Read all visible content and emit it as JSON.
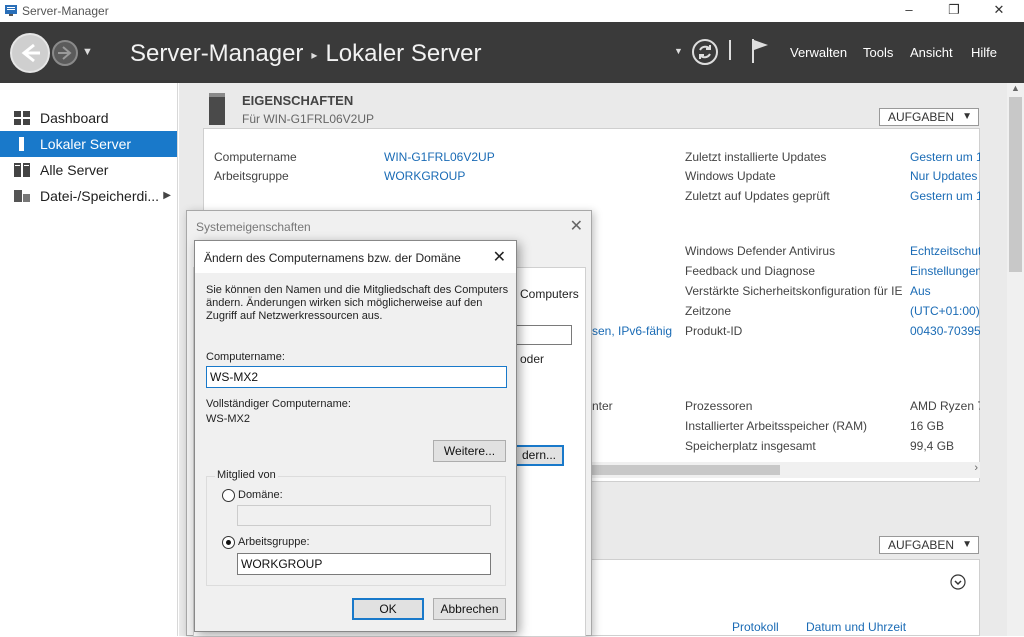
{
  "window": {
    "title": "Server-Manager",
    "controls": {
      "minimize": "–",
      "maximize": "❐",
      "close": "✕"
    }
  },
  "topbar": {
    "breadcrumb": [
      "Server-Manager",
      "Lokaler Server"
    ],
    "breadcrumb_sep": "▸",
    "menu": [
      "Verwalten",
      "Tools",
      "Ansicht",
      "Hilfe"
    ],
    "icons": [
      "back-arrow",
      "forward-arrow",
      "refresh-icon",
      "flag-icon"
    ]
  },
  "sidebar": {
    "items": [
      {
        "label": "Dashboard",
        "icon": "dashboard-icon"
      },
      {
        "label": "Lokaler Server",
        "icon": "server-icon",
        "active": true
      },
      {
        "label": "Alle Server",
        "icon": "servers-icon"
      },
      {
        "label": "Datei-/Speicherdi...",
        "icon": "storage-icon"
      }
    ]
  },
  "properties": {
    "title": "EIGENSCHAFTEN",
    "subtitle": "Für WIN-G1FRL06V2UP",
    "tasks_label": "AUFGABEN",
    "left": [
      {
        "label": "Computername",
        "value": "WIN-G1FRL06V2UP"
      },
      {
        "label": "Arbeitsgruppe",
        "value": "WORKGROUP"
      }
    ],
    "left_partial": {
      "ipv6": "sen, IPv6-fähig",
      "center": "nter"
    },
    "right_top": [
      {
        "label": "Zuletzt installierte Updates",
        "value": "Gestern um 1"
      },
      {
        "label": "Windows Update",
        "value": "Nur Updates"
      },
      {
        "label": "Zuletzt auf Updates geprüft",
        "value": "Gestern um 1"
      }
    ],
    "right_mid": [
      {
        "label": "Windows Defender Antivirus",
        "value": "Echtzeitschut"
      },
      {
        "label": "Feedback und Diagnose",
        "value": "Einstellungen"
      },
      {
        "label": "Verstärkte Sicherheitskonfiguration für IE",
        "value": "Aus"
      },
      {
        "label": "Zeitzone",
        "value": "(UTC+01:00)"
      },
      {
        "label": "Produkt-ID",
        "value": "00430-70395"
      }
    ],
    "right_bottom": [
      {
        "label": "Prozessoren",
        "value": "AMD Ryzen 7"
      },
      {
        "label": "Installierter Arbeitsspeicher (RAM)",
        "value": "16 GB"
      },
      {
        "label": "Speicherplatz insgesamt",
        "value": "99,4 GB"
      }
    ]
  },
  "events": {
    "tasks_label": "AUFGABEN",
    "columns": [
      "Protokoll",
      "Datum und Uhrzeit"
    ]
  },
  "sysprops_dialog": {
    "title": "Systemeigenschaften",
    "partial_text_1": "Computers",
    "partial_text_2": "oder",
    "partial_button": "dern..."
  },
  "rename_dialog": {
    "title": "Ändern des Computernamens bzw. der Domäne",
    "description": "Sie können den Namen und die Mitgliedschaft des Computers ändern. Änderungen wirken sich möglicherweise auf den Zugriff auf Netzwerkressourcen aus.",
    "computername_label": "Computername:",
    "computername_value": "WS-MX2",
    "fullname_label": "Vollständiger Computername:",
    "fullname_value": "WS-MX2",
    "more_button": "Weitere...",
    "member_of_label": "Mitglied von",
    "domain_label": "Domäne:",
    "domain_value": "",
    "workgroup_label": "Arbeitsgruppe:",
    "workgroup_value": "WORKGROUP",
    "selected_membership": "workgroup",
    "ok_button": "OK",
    "cancel_button": "Abbrechen"
  }
}
